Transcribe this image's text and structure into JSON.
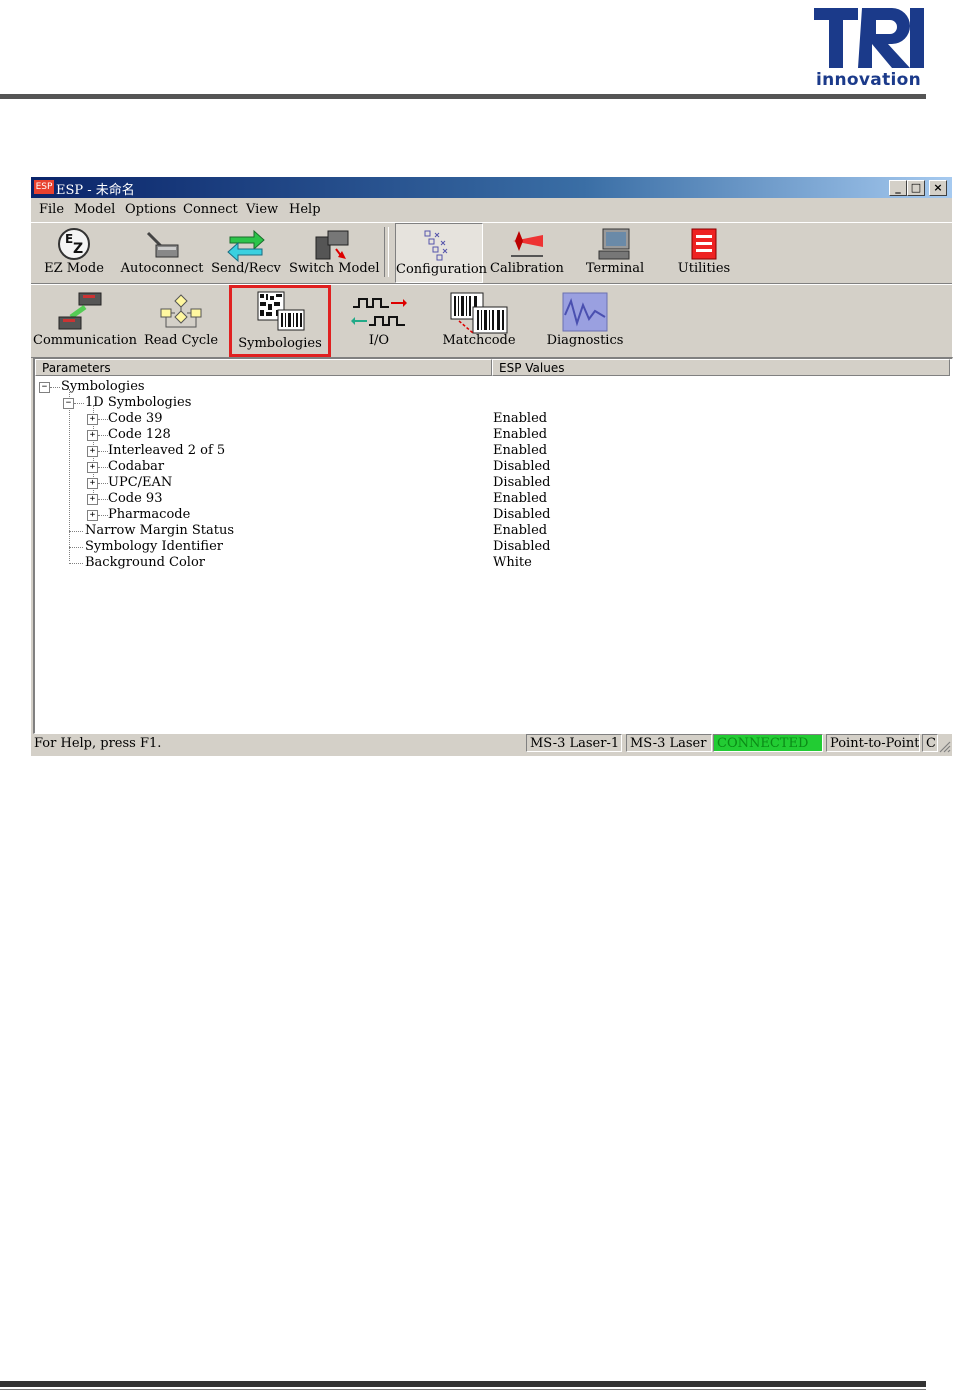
{
  "page": {
    "logo_text": "innovation"
  },
  "window": {
    "title": "ESP - 未命名",
    "app_icon_text": "ESP",
    "controls": {
      "minimize": "_",
      "maximize": "□",
      "close": "×"
    }
  },
  "menu": [
    "File",
    "Model",
    "Options",
    "Connect",
    "View",
    "Help"
  ],
  "toolbar_main": [
    {
      "label": "EZ Mode",
      "icon": "ez-mode-icon"
    },
    {
      "label": "Autoconnect",
      "icon": "autoconnect-icon"
    },
    {
      "label": "Send/Recv",
      "icon": "send-recv-icon"
    },
    {
      "label": "Switch Model",
      "icon": "switch-model-icon"
    },
    {
      "label": "Configuration",
      "icon": "configuration-icon",
      "pressed": true
    },
    {
      "label": "Calibration",
      "icon": "calibration-icon"
    },
    {
      "label": "Terminal",
      "icon": "terminal-icon"
    },
    {
      "label": "Utilities",
      "icon": "utilities-icon"
    }
  ],
  "toolbar_config": [
    {
      "label": "Communication",
      "icon": "communication-icon"
    },
    {
      "label": "Read Cycle",
      "icon": "read-cycle-icon"
    },
    {
      "label": "Symbologies",
      "icon": "symbologies-icon",
      "selected": true
    },
    {
      "label": "I/O",
      "icon": "io-icon"
    },
    {
      "label": "Matchcode",
      "icon": "matchcode-icon"
    },
    {
      "label": "Diagnostics",
      "icon": "diagnostics-icon"
    }
  ],
  "tree": {
    "headers": {
      "parameters": "Parameters",
      "values": "ESP Values"
    },
    "root": "Symbologies",
    "group": "1D Symbologies",
    "items": [
      {
        "name": "Code 39",
        "value": "Enabled"
      },
      {
        "name": "Code 128",
        "value": "Enabled"
      },
      {
        "name": "Interleaved 2 of 5",
        "value": "Enabled"
      },
      {
        "name": "Codabar",
        "value": "Disabled"
      },
      {
        "name": "UPC/EAN",
        "value": "Disabled"
      },
      {
        "name": "Code 93",
        "value": "Enabled"
      },
      {
        "name": "Pharmacode",
        "value": "Disabled"
      }
    ],
    "leaves": [
      {
        "name": "Narrow Margin Status",
        "value": "Enabled"
      },
      {
        "name": "Symbology Identifier",
        "value": "Disabled"
      },
      {
        "name": "Background Color",
        "value": "White"
      }
    ]
  },
  "status": {
    "help": "For Help, press F1.",
    "model": "MS-3 Laser-1",
    "device": "MS-3 Laser",
    "connection": "CONNECTED",
    "mode": "Point-to-Point",
    "extra": "C"
  },
  "colors": {
    "title_gradient_start": "#0a246a",
    "connected_bg": "#22cc33",
    "selected_border": "#e02020",
    "logo_blue": "#1b3a8a"
  }
}
